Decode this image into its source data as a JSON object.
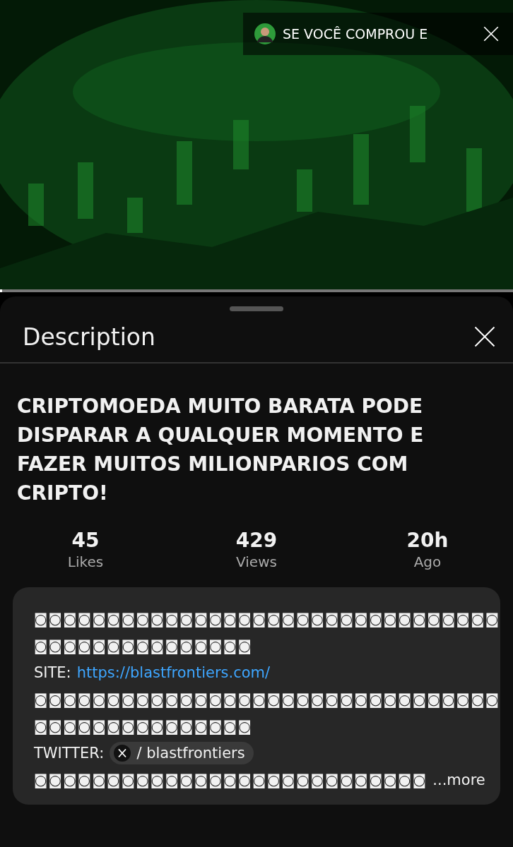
{
  "video": {
    "kind": "picture",
    "overlay_title": "SE VOCÊ COMPROU E",
    "progress": {
      "level": 0.004
    }
  },
  "sheet": {
    "title": "Description"
  },
  "video_title": "CRIPTOMOEDA MUITO BARATA PODE DISPARAR A QUALQUER MOMENTO E FAZER MUITOS MILIONPARIOS COM CRIPTO!",
  "stats": [
    {
      "value": "45",
      "label": "Likes"
    },
    {
      "value": "429",
      "label": "Views"
    },
    {
      "value": "20h",
      "label": "Ago"
    }
  ],
  "description": [
    {
      "kind": "text",
      "text": "◙◙◙◙◙◙◙◙◙◙◙◙◙◙◙◙◙◙◙◙◙◙◙◙◙◙◙◙◙◙◙◙"
    },
    {
      "kind": "text",
      "text": "◙◙◙◙◙◙◙◙◙◙◙◙◙◙◙"
    },
    {
      "kind": "link",
      "label": "SITE:",
      "link": "https://blastfrontiers.com/"
    },
    {
      "kind": "text",
      "text": "◙◙◙◙◙◙◙◙◙◙◙◙◙◙◙◙◙◙◙◙◙◙◙◙◙◙◙◙◙◙◙◙"
    },
    {
      "kind": "text",
      "text": "◙◙◙◙◙◙◙◙◙◙◙◙◙◙◙"
    },
    {
      "kind": "chip",
      "label": "TWITTER:",
      "chip": "/ blastfrontiers"
    },
    {
      "kind": "more",
      "text": "◙◙◙◙◙◙◙◙◙◙◙◙◙◙◙◙◙◙◙◙◙◙◙◙◙◙◙",
      "more": "...more"
    }
  ]
}
